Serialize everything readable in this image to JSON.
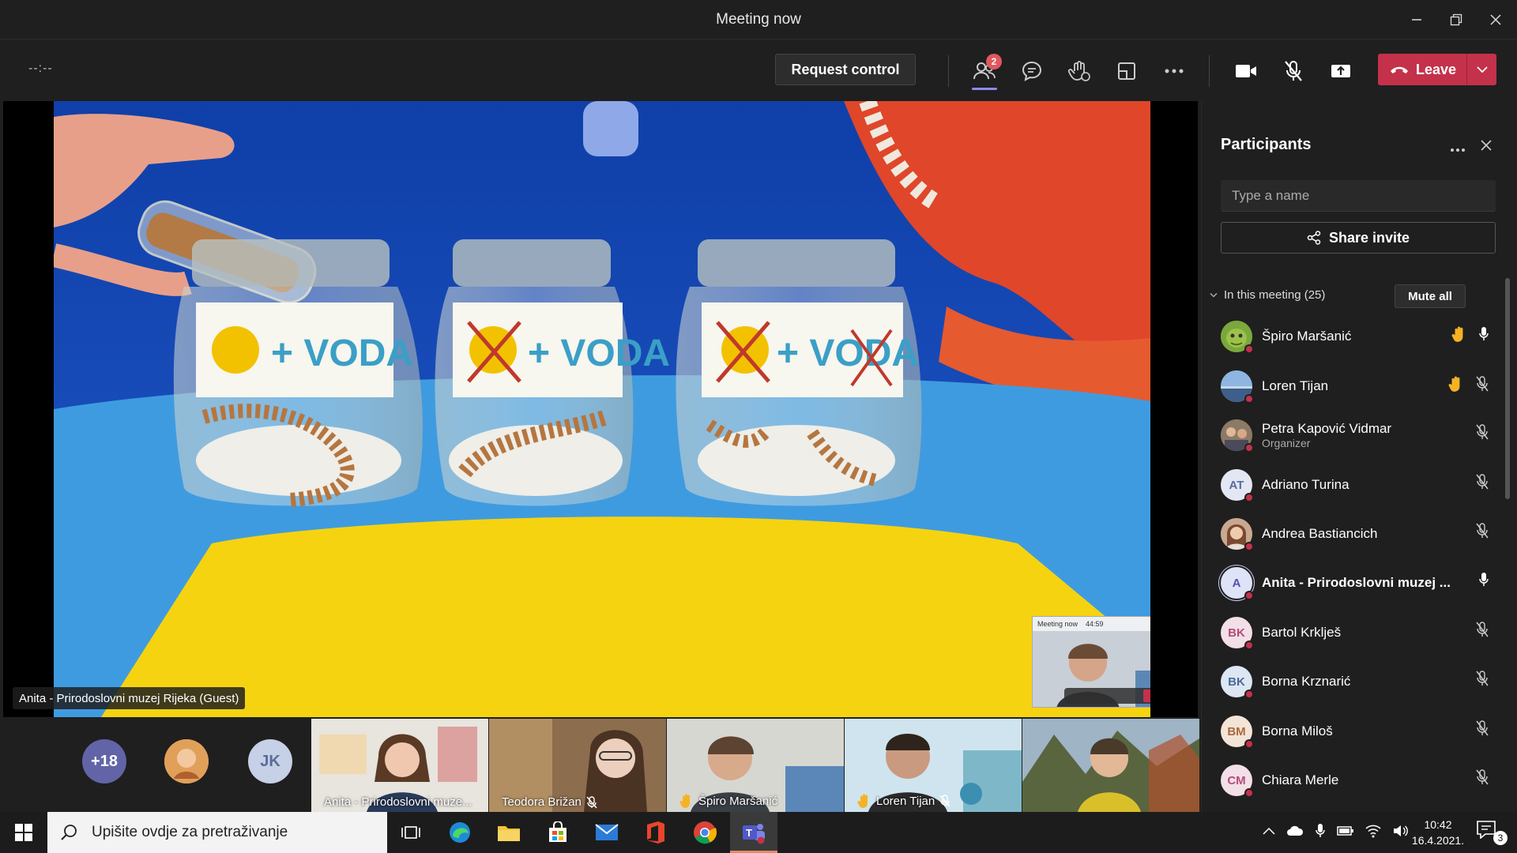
{
  "window": {
    "title": "Meeting now"
  },
  "toolbar": {
    "timer": "--:--",
    "request_control": "Request control",
    "participants_badge": "2",
    "leave": "Leave"
  },
  "stage": {
    "presenter_label": "Anita - Prirodoslovni muzej Rijeka (Guest)",
    "jar_label_water": "+ VODA",
    "pip": {
      "title": "Meeting now",
      "time": "44:59"
    }
  },
  "strip": {
    "overflow_count": "+18",
    "initials_avatar": "JK",
    "tiles": [
      {
        "name": "Anita - Prirodoslovni muze..."
      },
      {
        "name": "Teodora Brižan"
      },
      {
        "name": "Špiro Maršanić"
      },
      {
        "name": "Loren Tijan"
      },
      {
        "name": ""
      }
    ]
  },
  "panel": {
    "title": "Participants",
    "search_placeholder": "Type a name",
    "share_invite": "Share invite",
    "section_label": "In this meeting (25)",
    "mute_all": "Mute all",
    "participants": [
      {
        "name": "Špiro Maršanić",
        "role": "",
        "initials": "",
        "hand": true,
        "mic": "on"
      },
      {
        "name": "Loren Tijan",
        "role": "",
        "initials": "",
        "hand": true,
        "mic": "off"
      },
      {
        "name": "Petra Kapović Vidmar",
        "role": "Organizer",
        "initials": "",
        "hand": false,
        "mic": "off"
      },
      {
        "name": "Adriano Turina",
        "role": "",
        "initials": "AT",
        "hand": false,
        "mic": "off"
      },
      {
        "name": "Andrea Bastiancich",
        "role": "",
        "initials": "",
        "hand": false,
        "mic": "off"
      },
      {
        "name": "Anita - Prirodoslovni muzej ...",
        "role": "",
        "initials": "A",
        "hand": false,
        "mic": "on"
      },
      {
        "name": "Bartol Krklješ",
        "role": "",
        "initials": "BK",
        "hand": false,
        "mic": "off"
      },
      {
        "name": "Borna Krznarić",
        "role": "",
        "initials": "BK",
        "hand": false,
        "mic": "off"
      },
      {
        "name": "Borna Miloš",
        "role": "",
        "initials": "BM",
        "hand": false,
        "mic": "off"
      },
      {
        "name": "Chiara Merle",
        "role": "",
        "initials": "CM",
        "hand": false,
        "mic": "off"
      }
    ]
  },
  "taskbar": {
    "search_placeholder": "Upišite ovdje za pretraživanje",
    "time": "10:42",
    "date": "16.4.2021.",
    "notifications": "3"
  }
}
